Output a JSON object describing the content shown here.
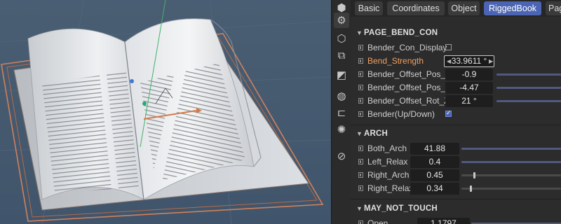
{
  "tabs": [
    "Basic",
    "Coordinates",
    "Object",
    "RiggedBook",
    "Pag"
  ],
  "active_tab": "RiggedBook",
  "toolstrip_icons": [
    "cube-icon",
    "gear-icon",
    "shield-icon",
    "transform-icon",
    "deform-icon",
    "globe-icon",
    "tag-icon",
    "light-icon",
    "brush-icon"
  ],
  "sections": {
    "page_bend": {
      "title": "PAGE_BEND_CON",
      "rows": [
        {
          "label": "Bender_Con_Display",
          "type": "checkbox",
          "checked": false
        },
        {
          "label": "Bend_Strength",
          "value": "33.9611 °",
          "highlight": true
        },
        {
          "label": "Bender_Offset_Pos_X",
          "value": "-0.9"
        },
        {
          "label": "Bender_Offset_Pos_Y",
          "value": "-4.47"
        },
        {
          "label": "Bender_Offset_Rot_Z",
          "value": "21 °"
        },
        {
          "label": "Bender(Up/Down)",
          "type": "checkbox",
          "checked": true
        }
      ]
    },
    "arch": {
      "title": "ARCH",
      "rows": [
        {
          "label": "Both_Arch",
          "value": "41.88",
          "slider": 1.0
        },
        {
          "label": "Left_Relax",
          "value": "0.4",
          "slider": 1.0
        },
        {
          "label": "Right_Arch",
          "value": "0.45",
          "slider": 0.11
        },
        {
          "label": "Right_Relax",
          "value": "0.34",
          "slider": 0.09
        }
      ]
    },
    "may_not_touch": {
      "title": "MAY_NOT_TOUCH",
      "rows": [
        {
          "label": "Open",
          "value": "1.1797"
        }
      ]
    }
  },
  "colors": {
    "viewport_bg": "#40556b",
    "panel_bg": "#2c2c2c",
    "accent": "#4b64b3",
    "highlight_label": "#f0a060",
    "selection_outline": "#d0805a"
  }
}
